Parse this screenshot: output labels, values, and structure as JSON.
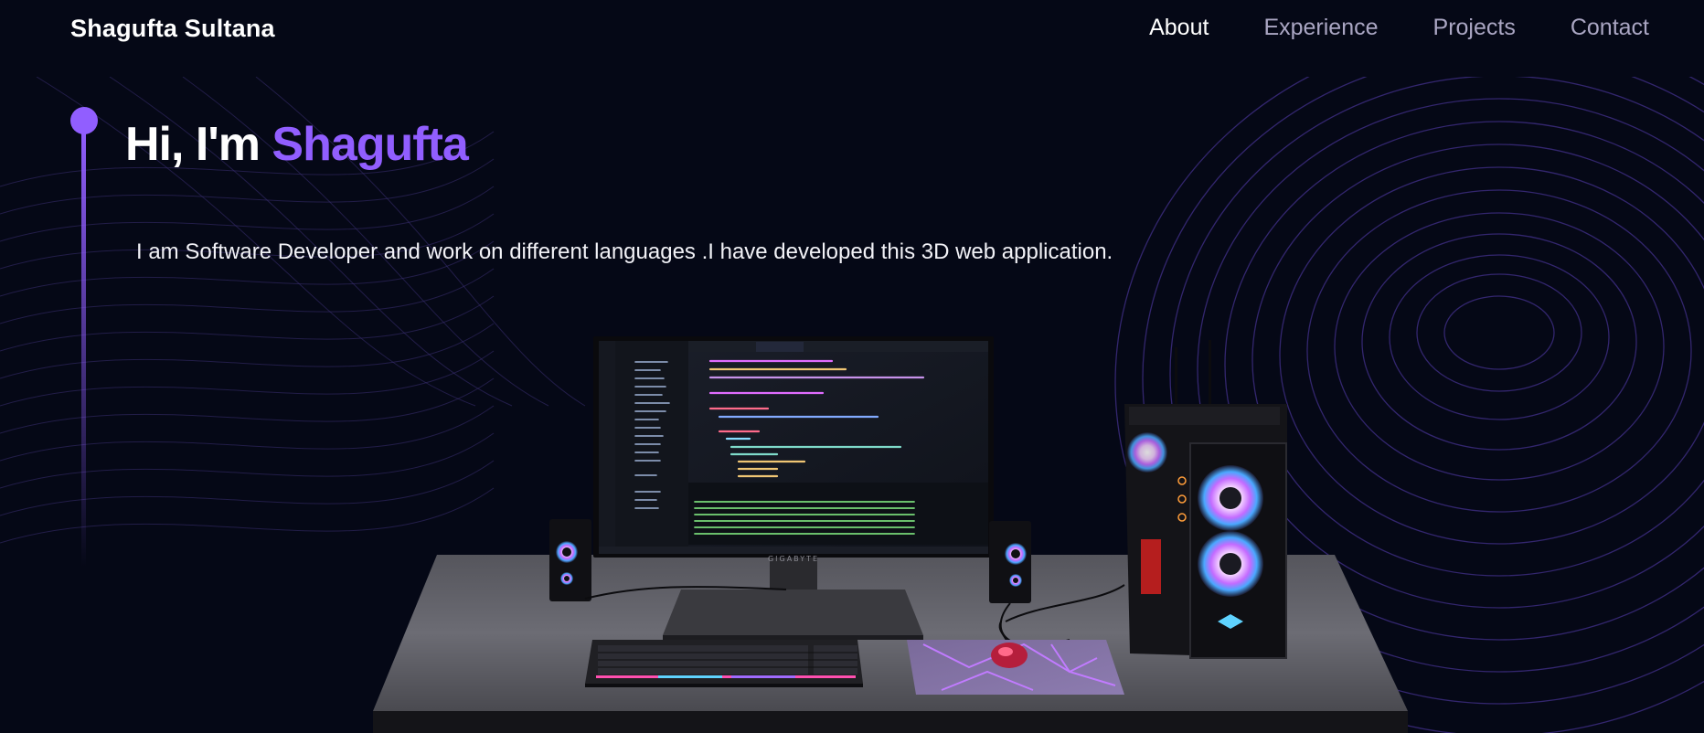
{
  "nav": {
    "brand": "Shagufta Sultana",
    "links": [
      {
        "label": "About",
        "active": true
      },
      {
        "label": "Experience",
        "active": false
      },
      {
        "label": "Projects",
        "active": false
      },
      {
        "label": "Contact",
        "active": false
      }
    ]
  },
  "hero": {
    "greeting": "Hi, I'm",
    "name": "Shagufta",
    "subtitle": "I am Software Developer and work on different languages .I have developed this 3D web application."
  },
  "colors": {
    "background": "#050816",
    "accent": "#915eff",
    "nav_inactive": "#aaa6c3",
    "text": "#ffffff"
  },
  "scene": {
    "monitor_brand": "GIGABYTE",
    "editor_tabs": [
      "style.js",
      "Computers.jsx",
      "Loader.jsx",
      "index.js",
      "Ball.jsx"
    ]
  }
}
